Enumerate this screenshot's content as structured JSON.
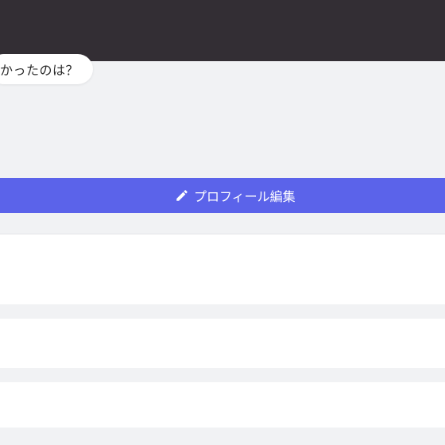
{
  "profile": {
    "question_bubble": "かったのは？",
    "edit_button_label": "プロフィール編集",
    "edit_icon": "pencil-icon"
  },
  "colors": {
    "cover": "#332e34",
    "background": "#f1f2f4",
    "accent": "#5b63ea",
    "card": "#ffffff"
  }
}
